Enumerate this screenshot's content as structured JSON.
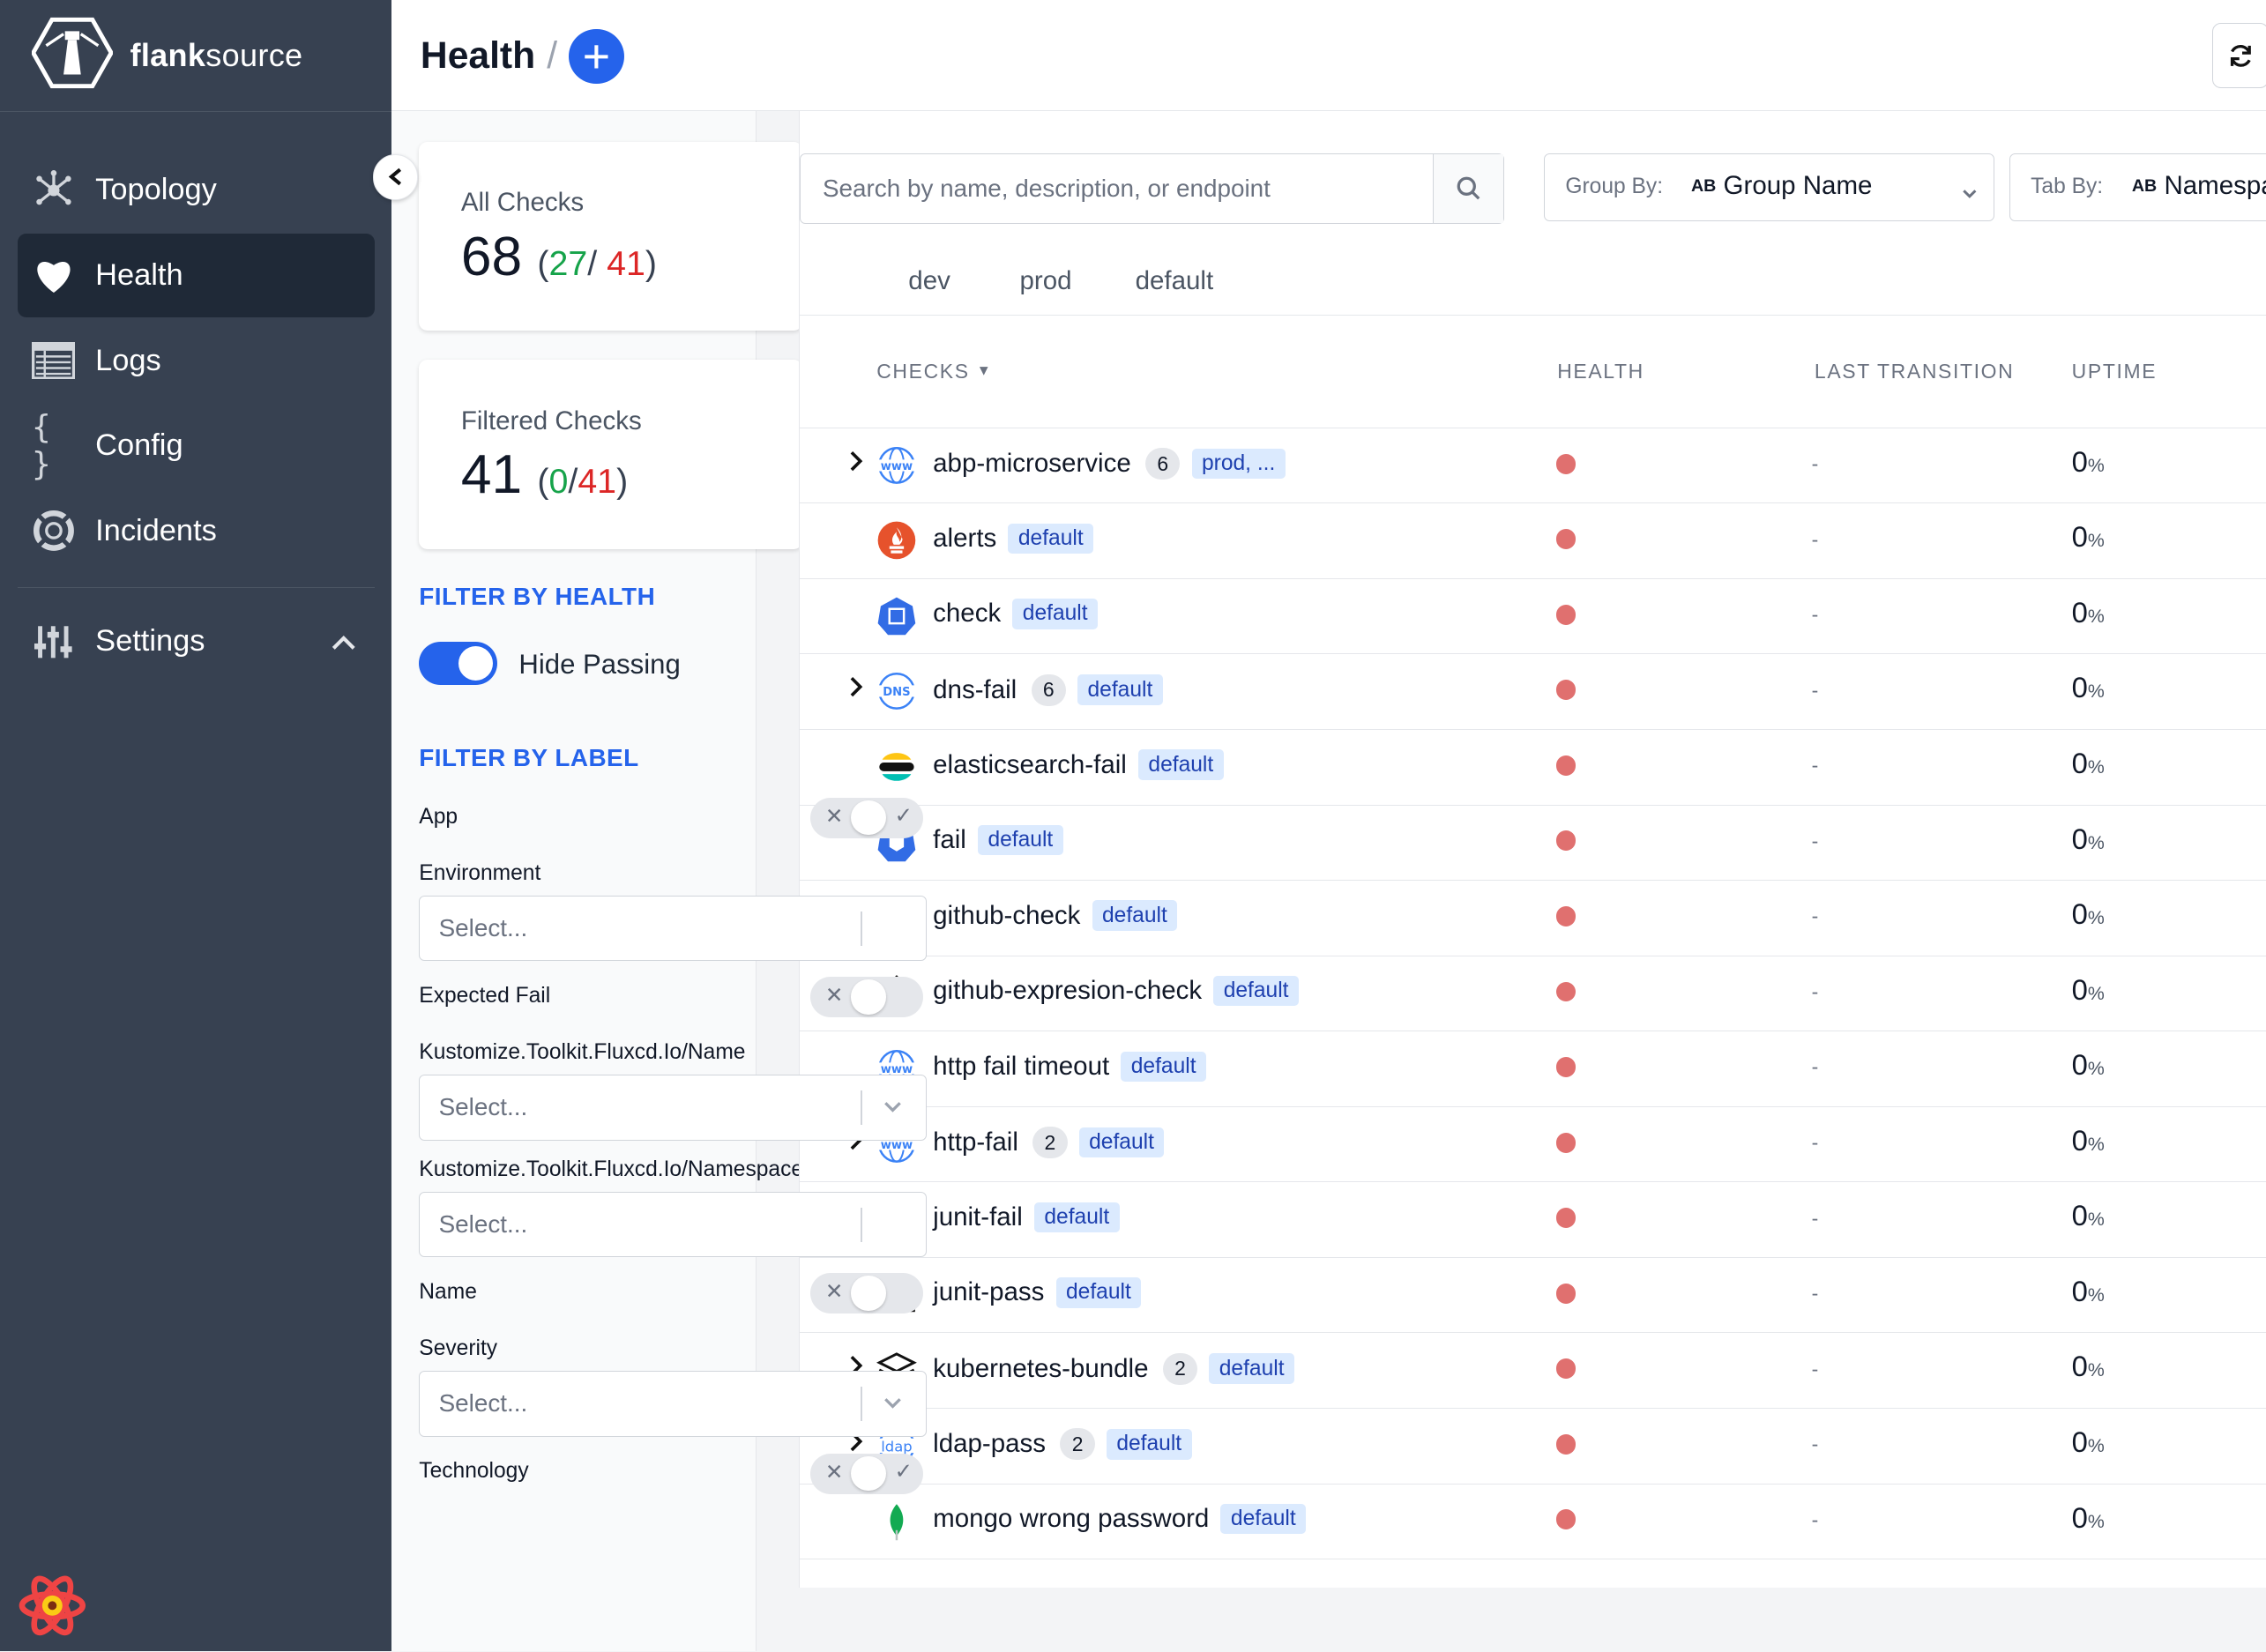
{
  "app": {
    "name_bold": "flank",
    "name_rest": "source"
  },
  "sidebar": {
    "items": [
      {
        "label": "Topology",
        "icon": "topology-icon"
      },
      {
        "label": "Health",
        "icon": "heart-icon",
        "active": true
      },
      {
        "label": "Logs",
        "icon": "logs-icon"
      },
      {
        "label": "Config",
        "icon": "braces-icon"
      },
      {
        "label": "Incidents",
        "icon": "lifebuoy-icon"
      }
    ],
    "settings_label": "Settings"
  },
  "header": {
    "title": "Health",
    "separator": "/"
  },
  "stats": {
    "all": {
      "title": "All Checks",
      "total": "68",
      "pass": "27",
      "sep": "/ ",
      "fail": "41"
    },
    "filtered": {
      "title": "Filtered Checks",
      "total": "41",
      "pass": "0",
      "sep": "/",
      "fail": "41"
    }
  },
  "filters": {
    "health_title": "FILTER BY HEALTH",
    "hide_passing": "Hide Passing",
    "label_title": "FILTER BY LABEL",
    "labels": [
      "App",
      "Environment",
      "Expected Fail",
      "Kustomize.Toolkit.Fluxcd.Io/Name",
      "Kustomize.Toolkit.Fluxcd.Io/Namespace",
      "Name",
      "Severity",
      "Technology"
    ],
    "select_placeholder": "Select..."
  },
  "search": {
    "placeholder": "Search by name, description, or endpoint"
  },
  "group_by": {
    "label": "Group By:",
    "value": "Group Name"
  },
  "tab_by": {
    "label": "Tab By:",
    "value": "Namespa"
  },
  "tabs": [
    "dev",
    "prod",
    "default"
  ],
  "table": {
    "headers": {
      "checks": "CHECKS",
      "health": "HEALTH",
      "last_transition": "LAST TRANSITION",
      "uptime": "UPTIME"
    },
    "rows": [
      {
        "name": "abp-microservice",
        "count": "6",
        "tag": "prod, ...",
        "icon": "www-icon",
        "expandable": true,
        "transition": "-",
        "uptime": "0",
        "unit": "%"
      },
      {
        "name": "alerts",
        "tag": "default",
        "icon": "prometheus-icon",
        "transition": "-",
        "uptime": "0",
        "unit": "%"
      },
      {
        "name": "check",
        "tag": "default",
        "icon": "kubernetes-icon",
        "transition": "-",
        "uptime": "0",
        "unit": "%"
      },
      {
        "name": "dns-fail",
        "count": "6",
        "tag": "default",
        "icon": "dns-icon",
        "expandable": true,
        "transition": "-",
        "uptime": "0",
        "unit": "%"
      },
      {
        "name": "elasticsearch-fail",
        "tag": "default",
        "icon": "elasticsearch-icon",
        "transition": "-",
        "uptime": "0",
        "unit": "%"
      },
      {
        "name": "fail",
        "tag": "default",
        "icon": "kubernetes-pod-icon",
        "transition": "-",
        "uptime": "0",
        "unit": "%"
      },
      {
        "name": "github-check",
        "tag": "default",
        "icon": "git-icon",
        "transition": "-",
        "uptime": "0",
        "unit": "%"
      },
      {
        "name": "github-expresion-check",
        "tag": "default",
        "icon": "git-icon",
        "transition": "-",
        "uptime": "0",
        "unit": "%"
      },
      {
        "name": "http fail timeout",
        "tag": "default",
        "icon": "www-icon",
        "transition": "-",
        "uptime": "0",
        "unit": "%"
      },
      {
        "name": "http-fail",
        "count": "2",
        "tag": "default",
        "icon": "www-icon",
        "expandable": true,
        "transition": "-",
        "uptime": "0",
        "unit": "%"
      },
      {
        "name": "junit-fail",
        "tag": "default",
        "icon": "junit-icon",
        "transition": "-",
        "uptime": "0",
        "unit": "%"
      },
      {
        "name": "junit-pass",
        "tag": "default",
        "icon": "junit-icon",
        "transition": "-",
        "uptime": "0",
        "unit": "%"
      },
      {
        "name": "kubernetes-bundle",
        "count": "2",
        "tag": "default",
        "icon": "layers-icon",
        "expandable": true,
        "transition": "-",
        "uptime": "0",
        "unit": "%"
      },
      {
        "name": "ldap-pass",
        "count": "2",
        "tag": "default",
        "icon": "ldap-icon",
        "expandable": true,
        "transition": "-",
        "uptime": "0",
        "unit": "%"
      },
      {
        "name": "mongo wrong password",
        "tag": "default",
        "icon": "mongodb-icon",
        "transition": "-",
        "uptime": "0",
        "unit": "%"
      }
    ]
  },
  "colors": {
    "accent": "#2563eb",
    "fail_dot": "#e0706f",
    "sidebar": "#374151"
  }
}
